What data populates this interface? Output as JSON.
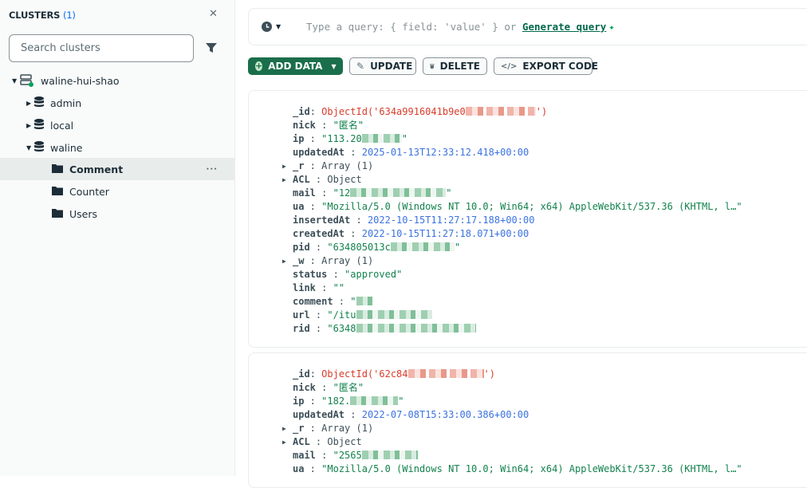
{
  "sidebar": {
    "title": "CLUSTERS",
    "count": "(1)",
    "search_placeholder": "Search clusters",
    "cluster": "waline-hui-shao",
    "databases": [
      {
        "name": "admin",
        "expanded": false
      },
      {
        "name": "local",
        "expanded": false
      },
      {
        "name": "waline",
        "expanded": true
      }
    ],
    "collections": [
      "Comment",
      "Counter",
      "Users"
    ],
    "selected": "Comment"
  },
  "query": {
    "placeholder": "Type a query: { field: 'value' } or",
    "generate": "Generate query"
  },
  "toolbar": {
    "add": "ADD DATA",
    "update": "UPDATE",
    "delete": "DELETE",
    "export": "EXPORT CODE"
  },
  "colors": {
    "accent": "#1a6e4b",
    "string": "#12824d",
    "date": "#3b73e0",
    "oid": "#d83c2a"
  },
  "documents": [
    {
      "fields": [
        {
          "k": "_id",
          "t": "oid",
          "v": "ObjectId('634a9916041b9e0",
          "end": "')",
          "red": true
        },
        {
          "k": "nick",
          "t": "string",
          "v": "\"匿名\""
        },
        {
          "k": "ip",
          "t": "string",
          "v": "\"113.20",
          "end": "\"",
          "red": true
        },
        {
          "k": "updatedAt",
          "t": "date",
          "v": "2025-01-13T12:33:12.418+00:00"
        },
        {
          "k": "_r",
          "t": "plain",
          "v": "Array (1)",
          "exp": true
        },
        {
          "k": "ACL",
          "t": "plain",
          "v": "Object",
          "exp": true
        },
        {
          "k": "mail",
          "t": "string",
          "v": "\"12",
          "end": "\"",
          "red": true
        },
        {
          "k": "ua",
          "t": "string",
          "v": "\"Mozilla/5.0 (Windows NT 10.0; Win64; x64) AppleWebKit/537.36 (KHTML, l…\""
        },
        {
          "k": "insertedAt",
          "t": "date",
          "v": "2022-10-15T11:27:17.188+00:00"
        },
        {
          "k": "createdAt",
          "t": "date",
          "v": "2022-10-15T11:27:18.071+00:00"
        },
        {
          "k": "pid",
          "t": "string",
          "v": "\"634805013c",
          "end": "\"",
          "red": true
        },
        {
          "k": "_w",
          "t": "plain",
          "v": "Array (1)",
          "exp": true
        },
        {
          "k": "status",
          "t": "string",
          "v": "\"approved\""
        },
        {
          "k": "link",
          "t": "string",
          "v": "\"\""
        },
        {
          "k": "comment",
          "t": "string",
          "v": "\"",
          "red": true
        },
        {
          "k": "url",
          "t": "string",
          "v": "\"/itu",
          "red": true
        },
        {
          "k": "rid",
          "t": "string",
          "v": "\"6348",
          "red": true
        }
      ]
    },
    {
      "fields": [
        {
          "k": "_id",
          "t": "oid",
          "v": "ObjectId('62c84",
          "end": "')",
          "red": true
        },
        {
          "k": "nick",
          "t": "string",
          "v": "\"匿名\""
        },
        {
          "k": "ip",
          "t": "string",
          "v": "\"182.",
          "end": "\"",
          "red": true
        },
        {
          "k": "updatedAt",
          "t": "date",
          "v": "2022-07-08T15:33:00.386+00:00"
        },
        {
          "k": "_r",
          "t": "plain",
          "v": "Array (1)",
          "exp": true
        },
        {
          "k": "ACL",
          "t": "plain",
          "v": "Object",
          "exp": true
        },
        {
          "k": "mail",
          "t": "string",
          "v": "\"2565",
          "red": true
        },
        {
          "k": "ua",
          "t": "string",
          "v": "\"Mozilla/5.0 (Windows NT 10.0; Win64; x64) AppleWebKit/537.36 (KHTML, l…\""
        }
      ]
    }
  ]
}
